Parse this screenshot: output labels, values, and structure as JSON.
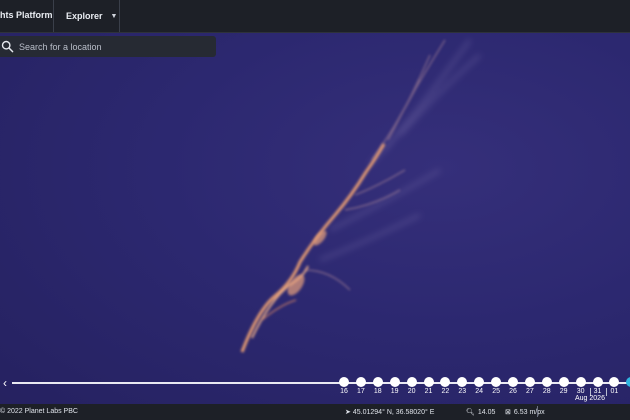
{
  "header": {
    "brand_text": "hts Platform",
    "explorer_label": "Explorer",
    "explorer_chevron": "chevron-down-icon"
  },
  "search": {
    "placeholder": "Search for a location",
    "value": "",
    "icon": "search-icon"
  },
  "timeline": {
    "back_icon": "chevron-left-icon",
    "days": [
      "16",
      "17",
      "18",
      "19",
      "20",
      "21",
      "22",
      "23",
      "24",
      "25",
      "26",
      "27",
      "28",
      "29",
      "30",
      "31",
      "01"
    ],
    "active_index": 17,
    "month_label": "Aug 2026",
    "accent_color": "#2fb4e0"
  },
  "status": {
    "copyright": "2022 Planet Labs PBC",
    "coordinates": "45.01294° N, 36.58020° E",
    "zoom": "14.05",
    "resolution": "6.53 m/px"
  },
  "colors": {
    "sea": "#2c2870",
    "slick": "#d98a6a",
    "topbar": "#1d2027"
  }
}
